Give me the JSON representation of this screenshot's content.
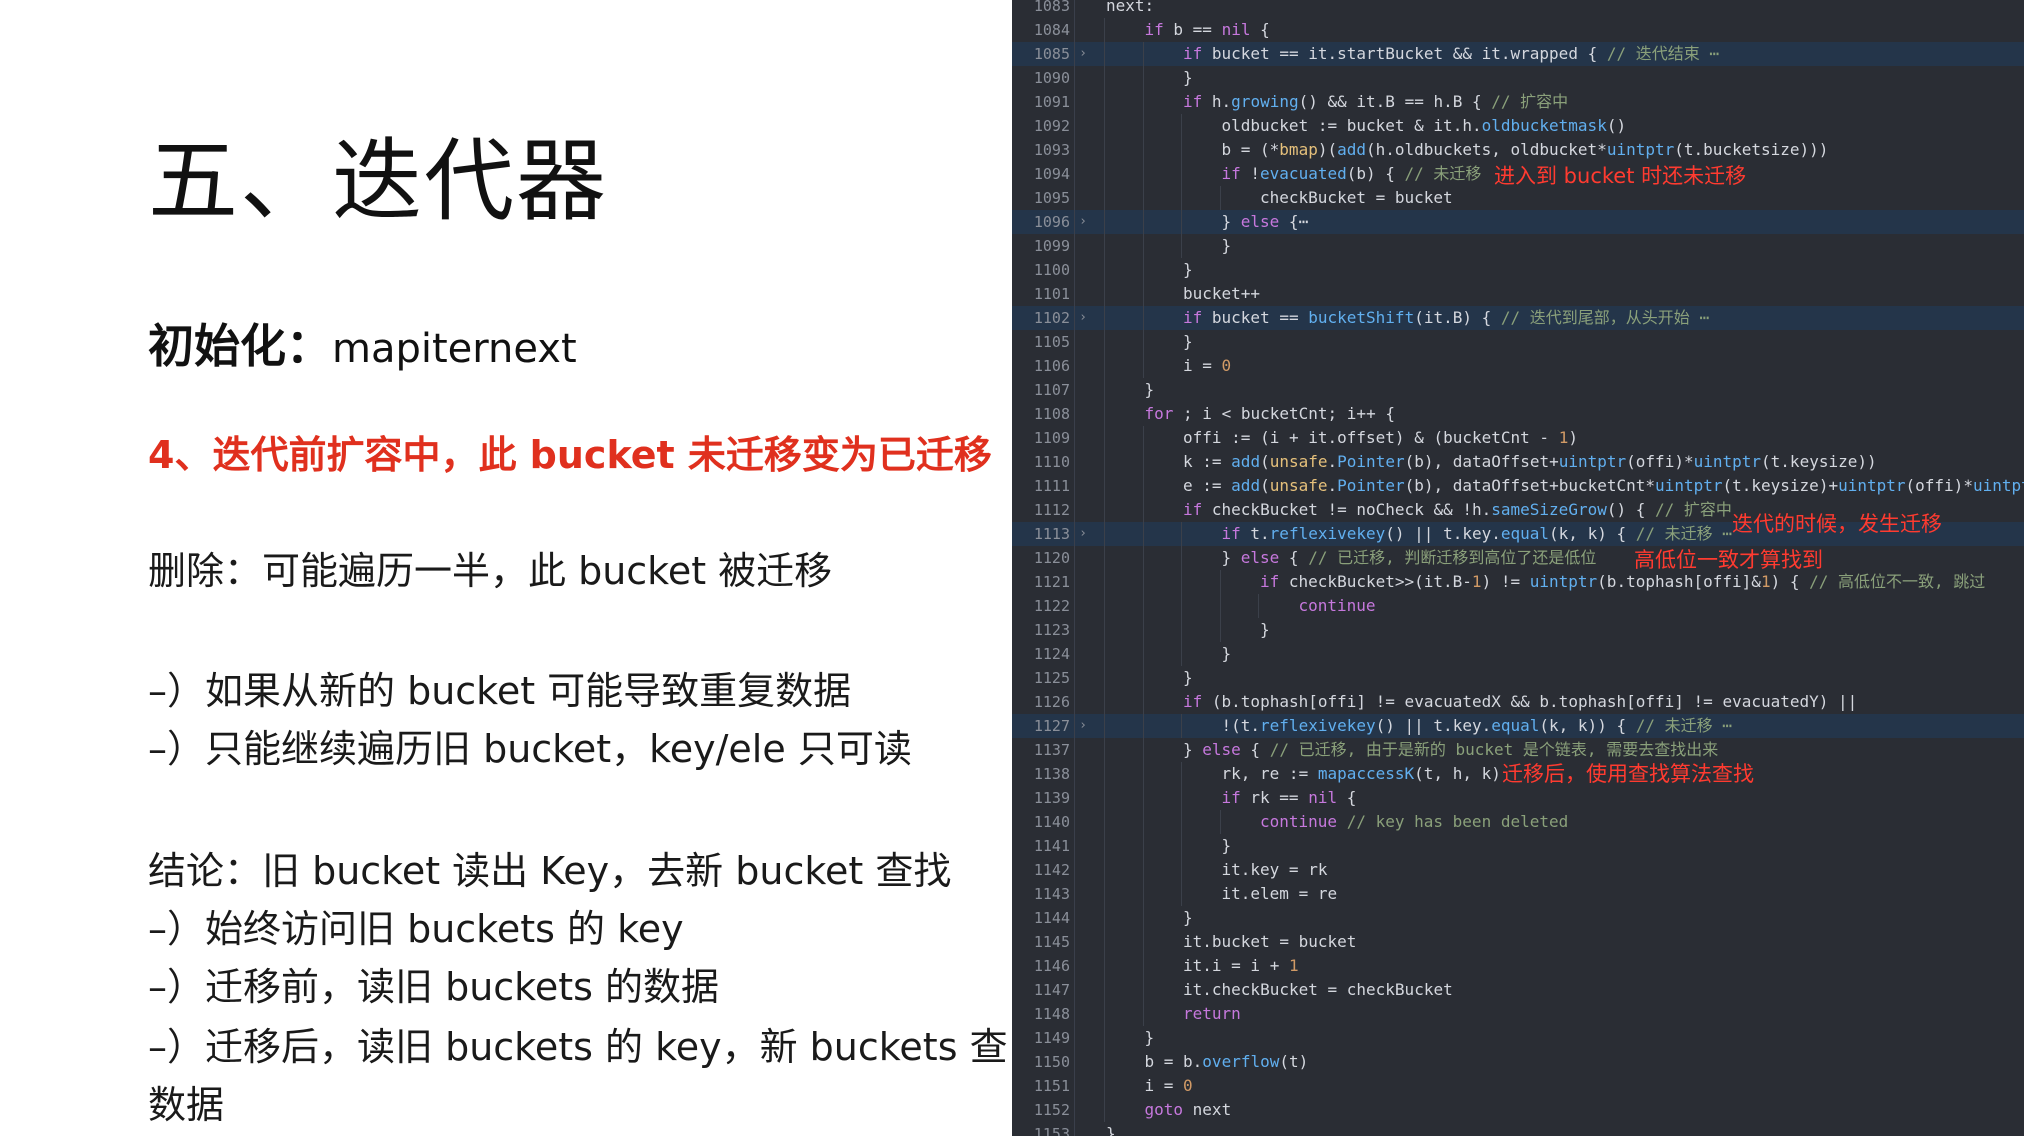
{
  "slide": {
    "title": "五、迭代器",
    "subtitle_bold": "初始化：",
    "subtitle_plain": "mapiternext",
    "red_point": "4、迭代前扩容中，此 bucket 未迁移变为已迁移",
    "delete_line": "删除：可能遍历一半，此 bucket 被迁移",
    "bullet1": "–）如果从新的 bucket 可能导致重复数据",
    "bullet2": "–）只能继续遍历旧 bucket，key/ele 只可读",
    "conclusion": "结论：旧 bucket 读出 Key，去新 bucket 查找",
    "c_bullet1": "–）始终访问旧 buckets 的 key",
    "c_bullet2": "–）迁移前，读旧 buckets 的数据",
    "c_bullet3": "–）迁移后，读旧 buckets 的 key，新 buckets 查",
    "c_bullet3_wrap": "数据"
  },
  "editor": {
    "lines": [
      {
        "n": "1083",
        "indent": 0,
        "text": "next:"
      },
      {
        "n": "1084",
        "indent": 1,
        "text": "if b == nil {"
      },
      {
        "n": "1085",
        "indent": 2,
        "text": "if bucket == it.startBucket && it.wrapped { // 迭代结束 ⋯",
        "fold": true,
        "hl": true
      },
      {
        "n": "1090",
        "indent": 2,
        "text": "}"
      },
      {
        "n": "1091",
        "indent": 2,
        "text": "if h.growing() && it.B == h.B { // 扩容中"
      },
      {
        "n": "1092",
        "indent": 3,
        "text": "oldbucket := bucket & it.h.oldbucketmask()"
      },
      {
        "n": "1093",
        "indent": 3,
        "text": "b = (*bmap)(add(h.oldbuckets, oldbucket*uintptr(t.bucketsize)))"
      },
      {
        "n": "1094",
        "indent": 3,
        "text": "if !evacuated(b) { // 未迁移"
      },
      {
        "n": "1095",
        "indent": 4,
        "text": "checkBucket = bucket"
      },
      {
        "n": "1096",
        "indent": 3,
        "text": "} else {⋯",
        "fold": true,
        "hl": true
      },
      {
        "n": "1099",
        "indent": 3,
        "text": "}"
      },
      {
        "n": "1100",
        "indent": 2,
        "text": "}"
      },
      {
        "n": "1101",
        "indent": 2,
        "text": "bucket++"
      },
      {
        "n": "1102",
        "indent": 2,
        "text": "if bucket == bucketShift(it.B) { // 迭代到尾部，从头开始 ⋯",
        "fold": true,
        "hl": true
      },
      {
        "n": "1105",
        "indent": 2,
        "text": "}"
      },
      {
        "n": "1106",
        "indent": 2,
        "text": "i = 0"
      },
      {
        "n": "1107",
        "indent": 1,
        "text": "}"
      },
      {
        "n": "1108",
        "indent": 1,
        "text": "for ; i < bucketCnt; i++ {"
      },
      {
        "n": "1109",
        "indent": 2,
        "text": "offi := (i + it.offset) & (bucketCnt - 1)"
      },
      {
        "n": "1110",
        "indent": 2,
        "text": "k := add(unsafe.Pointer(b), dataOffset+uintptr(offi)*uintptr(t.keysize))"
      },
      {
        "n": "1111",
        "indent": 2,
        "text": "e := add(unsafe.Pointer(b), dataOffset+bucketCnt*uintptr(t.keysize)+uintptr(offi)*uintptr(t.elemsize))"
      },
      {
        "n": "1112",
        "indent": 2,
        "text": "if checkBucket != noCheck && !h.sameSizeGrow() { // 扩容中"
      },
      {
        "n": "1113",
        "indent": 3,
        "text": "if t.reflexivekey() || t.key.equal(k, k) { // 未迁移 ⋯",
        "fold": true,
        "hl": true
      },
      {
        "n": "1120",
        "indent": 3,
        "text": "} else { // 已迁移, 判断迁移到高位了还是低位"
      },
      {
        "n": "1121",
        "indent": 4,
        "text": "if checkBucket>>(it.B-1) != uintptr(b.tophash[offi]&1) { // 高低位不一致, 跳过"
      },
      {
        "n": "1122",
        "indent": 5,
        "text": "continue"
      },
      {
        "n": "1123",
        "indent": 4,
        "text": "}"
      },
      {
        "n": "1124",
        "indent": 3,
        "text": "}"
      },
      {
        "n": "1125",
        "indent": 2,
        "text": "}"
      },
      {
        "n": "1126",
        "indent": 2,
        "text": "if (b.tophash[offi] != evacuatedX && b.tophash[offi] != evacuatedY) ||"
      },
      {
        "n": "1127",
        "indent": 3,
        "text": "!(t.reflexivekey() || t.key.equal(k, k)) { // 未迁移 ⋯",
        "fold": true,
        "hl": true
      },
      {
        "n": "1137",
        "indent": 2,
        "text": "} else { // 已迁移, 由于是新的 bucket 是个链表, 需要去查找出来"
      },
      {
        "n": "1138",
        "indent": 3,
        "text": "rk, re := mapaccessK(t, h, k)"
      },
      {
        "n": "1139",
        "indent": 3,
        "text": "if rk == nil {"
      },
      {
        "n": "1140",
        "indent": 4,
        "text": "continue // key has been deleted"
      },
      {
        "n": "1141",
        "indent": 3,
        "text": "}"
      },
      {
        "n": "1142",
        "indent": 3,
        "text": "it.key = rk"
      },
      {
        "n": "1143",
        "indent": 3,
        "text": "it.elem = re"
      },
      {
        "n": "1144",
        "indent": 2,
        "text": "}"
      },
      {
        "n": "1145",
        "indent": 2,
        "text": "it.bucket = bucket"
      },
      {
        "n": "1146",
        "indent": 2,
        "text": "it.i = i + 1"
      },
      {
        "n": "1147",
        "indent": 2,
        "text": "it.checkBucket = checkBucket"
      },
      {
        "n": "1148",
        "indent": 2,
        "text": "return"
      },
      {
        "n": "1149",
        "indent": 1,
        "text": "}"
      },
      {
        "n": "1150",
        "indent": 1,
        "text": "b = b.overflow(t)"
      },
      {
        "n": "1151",
        "indent": 1,
        "text": "i = 0"
      },
      {
        "n": "1152",
        "indent": 1,
        "text": "goto next"
      },
      {
        "n": "1153",
        "indent": 0,
        "text": "}"
      }
    ],
    "annotations": {
      "a1": "进入到 bucket 时还未迁移",
      "a2": "迭代的时候，发生迁移",
      "a3": "高低位一致才算找到",
      "a4": "迁移后，使用查找算法查找"
    }
  }
}
